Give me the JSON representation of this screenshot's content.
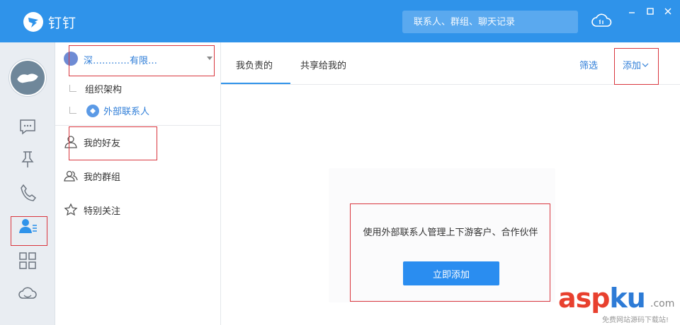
{
  "app": {
    "title": "钉钉"
  },
  "search": {
    "placeholder": "联系人、群组、聊天记录"
  },
  "org": {
    "name": "深…………有限…"
  },
  "tree": [
    {
      "label": "组织架构"
    },
    {
      "label": "外部联系人"
    }
  ],
  "nav": [
    {
      "label": "我的好友"
    },
    {
      "label": "我的群组"
    },
    {
      "label": "特别关注"
    }
  ],
  "tabs": [
    {
      "label": "我负责的"
    },
    {
      "label": "共享给我的"
    }
  ],
  "actions": {
    "filter": "筛选",
    "add": "添加"
  },
  "empty": {
    "message": "使用外部联系人管理上下游客户、合作伙伴",
    "button": "立即添加"
  },
  "watermark": {
    "main_a": "asp",
    "main_k": "ku",
    "com": ".com",
    "sub": "免费网站源码下载站!"
  },
  "colors": {
    "brand": "#2f93ea",
    "link": "#2f7ed8",
    "highlight": "#d9363e"
  },
  "icons": {
    "rail": [
      "chat-icon",
      "pin-icon",
      "phone-icon",
      "contacts-icon",
      "apps-icon",
      "cloud-icon"
    ]
  }
}
